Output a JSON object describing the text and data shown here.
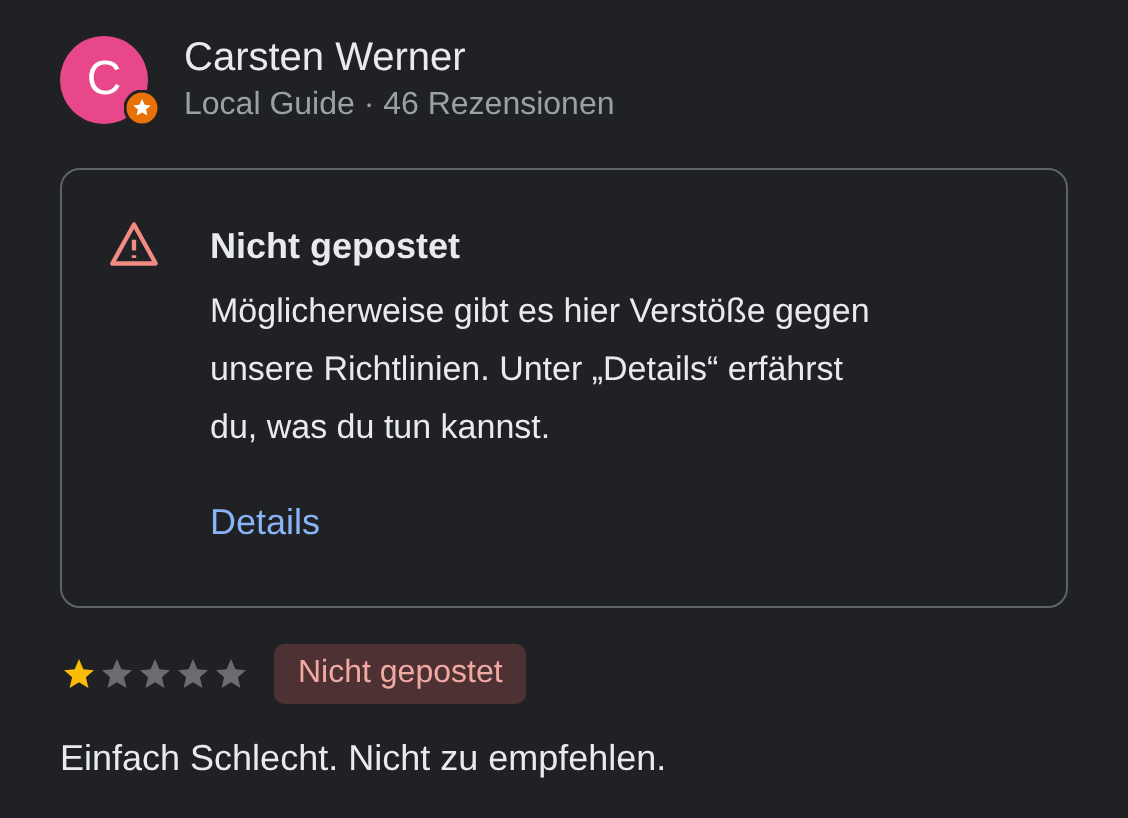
{
  "reviewer": {
    "initial": "C",
    "name": "Carsten Werner",
    "subtitle": "Local Guide · 46 Rezensionen",
    "local_guide": true
  },
  "notice": {
    "title": "Nicht gepostet",
    "message": "Möglicherweise gibt es hier Verstöße gegen unsere Richtlinien. Unter „Details“ erfährst du, was du tun kannst.",
    "link": "Details"
  },
  "review": {
    "stars": 1,
    "badge": "Nicht gepostet",
    "text": "Einfach Schlecht. Nicht zu empfehlen."
  }
}
